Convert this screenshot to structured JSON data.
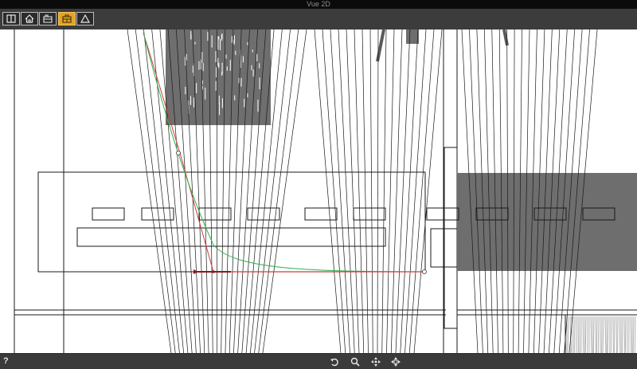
{
  "window": {
    "title": "Vue 2D"
  },
  "toolbar": {
    "buttons": [
      {
        "name": "panel-toggle",
        "icon": "panel-icon",
        "active": false
      },
      {
        "name": "view-home",
        "icon": "home-icon",
        "active": false
      },
      {
        "name": "view-front",
        "icon": "front-view-icon",
        "active": false
      },
      {
        "name": "view-side",
        "icon": "side-view-icon",
        "active": true
      },
      {
        "name": "view-roof",
        "icon": "roof-icon",
        "active": false
      }
    ],
    "active_color": "#e2a52a"
  },
  "statusbar": {
    "help_label": "?",
    "nav_buttons": [
      {
        "name": "undo",
        "icon": "undo-icon"
      },
      {
        "name": "zoom",
        "icon": "magnifier-icon"
      },
      {
        "name": "pan",
        "icon": "move-arrows-icon"
      },
      {
        "name": "rotate",
        "icon": "rotate-arrows-icon"
      }
    ]
  },
  "canvas": {
    "background": "#ffffff",
    "line_color": "#1a1a1a",
    "fill_dark": "#6e6e6e",
    "curve_colors": {
      "primary": "#d23a3a",
      "secondary": "#2fb34a",
      "handle": "#7a3a1a"
    }
  }
}
